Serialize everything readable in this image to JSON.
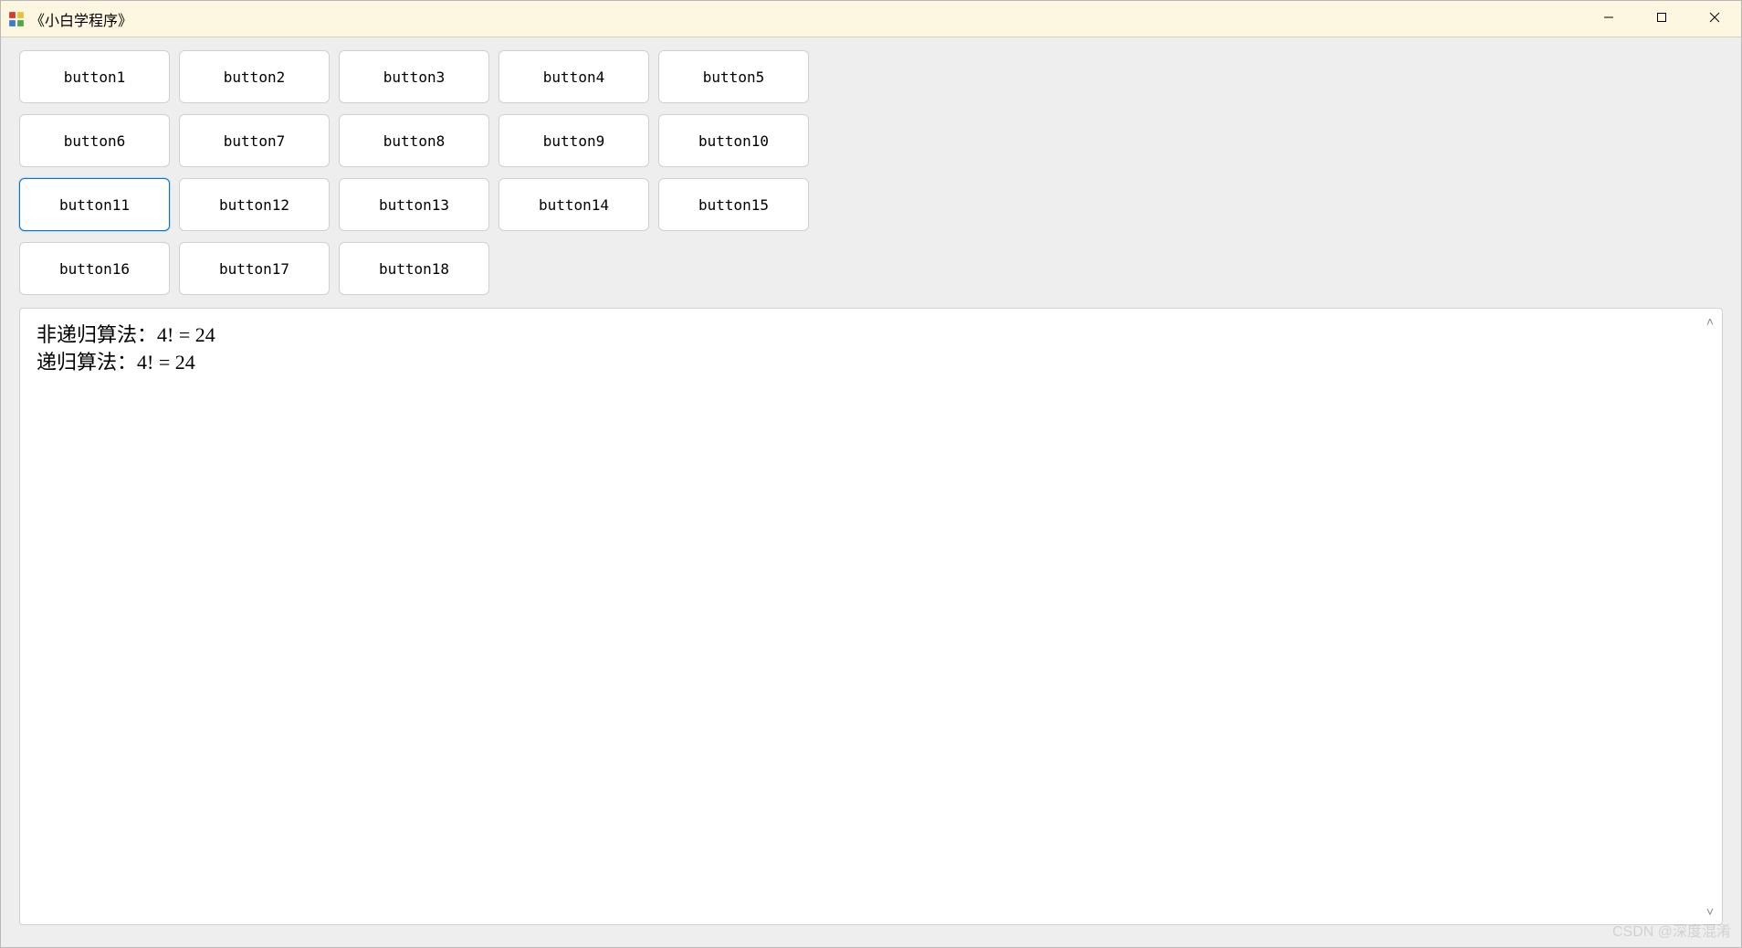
{
  "window": {
    "title": "《小白学程序》"
  },
  "buttons": {
    "rows": [
      [
        {
          "id": "button1",
          "label": "button1",
          "selected": false
        },
        {
          "id": "button2",
          "label": "button2",
          "selected": false
        },
        {
          "id": "button3",
          "label": "button3",
          "selected": false
        },
        {
          "id": "button4",
          "label": "button4",
          "selected": false
        },
        {
          "id": "button5",
          "label": "button5",
          "selected": false
        }
      ],
      [
        {
          "id": "button6",
          "label": "button6",
          "selected": false
        },
        {
          "id": "button7",
          "label": "button7",
          "selected": false
        },
        {
          "id": "button8",
          "label": "button8",
          "selected": false
        },
        {
          "id": "button9",
          "label": "button9",
          "selected": false
        },
        {
          "id": "button10",
          "label": "button10",
          "selected": false
        }
      ],
      [
        {
          "id": "button11",
          "label": "button11",
          "selected": true
        },
        {
          "id": "button12",
          "label": "button12",
          "selected": false
        },
        {
          "id": "button13",
          "label": "button13",
          "selected": false
        },
        {
          "id": "button14",
          "label": "button14",
          "selected": false
        },
        {
          "id": "button15",
          "label": "button15",
          "selected": false
        }
      ],
      [
        {
          "id": "button16",
          "label": "button16",
          "selected": false
        },
        {
          "id": "button17",
          "label": "button17",
          "selected": false
        },
        {
          "id": "button18",
          "label": "button18",
          "selected": false
        }
      ]
    ]
  },
  "output": {
    "text": "非递归算法：4! = 24\n递归算法：4! = 24"
  },
  "watermark": "CSDN @深度混淆"
}
